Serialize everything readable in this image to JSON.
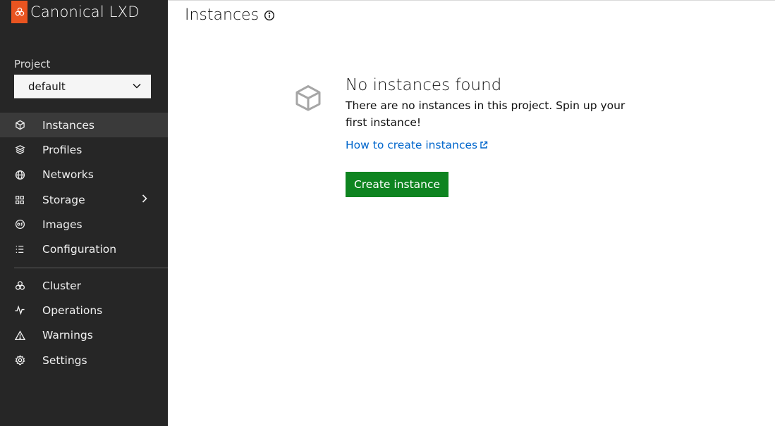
{
  "brand": {
    "name": "Canonical LXD",
    "logo_icon": "lxd-logo-icon",
    "logo_color": "#E95420"
  },
  "project": {
    "label": "Project",
    "selected": "default"
  },
  "nav": {
    "items": [
      {
        "label": "Instances",
        "icon": "cube-icon",
        "active": true
      },
      {
        "label": "Profiles",
        "icon": "layers-icon"
      },
      {
        "label": "Networks",
        "icon": "globe-icon"
      },
      {
        "label": "Storage",
        "icon": "grid-icon",
        "has_submenu": true
      },
      {
        "label": "Images",
        "icon": "os-image-icon"
      },
      {
        "label": "Configuration",
        "icon": "list-icon"
      }
    ],
    "secondary": [
      {
        "label": "Cluster",
        "icon": "cluster-icon"
      },
      {
        "label": "Operations",
        "icon": "pulse-icon"
      },
      {
        "label": "Warnings",
        "icon": "warning-icon"
      },
      {
        "label": "Settings",
        "icon": "gear-icon"
      }
    ]
  },
  "main": {
    "title": "Instances",
    "empty": {
      "title": "No instances found",
      "text": "There are no instances in this project. Spin up your first instance!",
      "link": "How to create instances",
      "button": "Create instance"
    }
  },
  "colors": {
    "sidebar_bg": "#262626",
    "active_bg": "#3A3A3A",
    "primary_button": "#0E8420",
    "link": "#0066CC"
  }
}
